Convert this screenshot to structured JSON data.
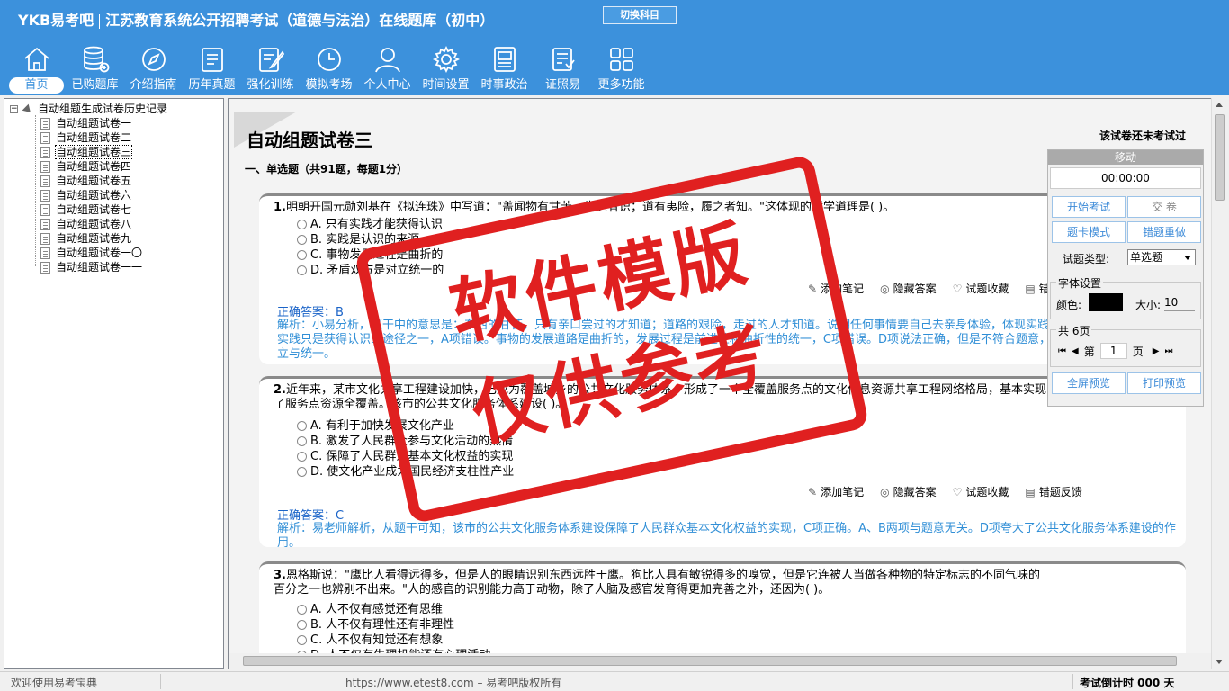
{
  "header": {
    "brand": "YKB易考吧",
    "title": "江苏教育系统公开招聘考试（道德与法治）在线题库（初中）",
    "switch_label": "切换科目"
  },
  "nav": [
    {
      "label": "首页",
      "icon": "home-icon"
    },
    {
      "label": "已购题库",
      "icon": "database-icon"
    },
    {
      "label": "介绍指南",
      "icon": "compass-icon"
    },
    {
      "label": "历年真题",
      "icon": "list-doc-icon"
    },
    {
      "label": "强化训练",
      "icon": "edit-doc-icon"
    },
    {
      "label": "模拟考场",
      "icon": "clock-icon"
    },
    {
      "label": "个人中心",
      "icon": "user-icon"
    },
    {
      "label": "时间设置",
      "icon": "gear-icon"
    },
    {
      "label": "时事政治",
      "icon": "news-icon"
    },
    {
      "label": "证照易",
      "icon": "certificate-icon"
    },
    {
      "label": "更多功能",
      "icon": "grid-icon"
    }
  ],
  "tree": {
    "root": "自动组题生成试卷历史记录",
    "items": [
      "自动组题试卷一",
      "自动组题试卷二",
      "自动组题试卷三",
      "自动组题试卷四",
      "自动组题试卷五",
      "自动组题试卷六",
      "自动组题试卷七",
      "自动组题试卷八",
      "自动组题试卷九",
      "自动组题试卷一〇",
      "自动组题试卷一一"
    ],
    "selected_index": 2
  },
  "paper": {
    "title": "自动组题试卷三",
    "status": "该试卷还未考试过",
    "section": "一、单选题（共91题，每题1分）"
  },
  "tools": {
    "note": "添加笔记",
    "hide": "隐藏答案",
    "fav": "试题收藏",
    "feedback": "错题反馈"
  },
  "questions": [
    {
      "num": "1.",
      "stem": "明朝开国元勋刘基在《拟连珠》中写道：\"盖闻物有甘苦，尝之者识；道有夷险，履之者知。\"这体现的哲学道理是( )。",
      "options": [
        "A. 只有实践才能获得认识",
        "B. 实践是认识的来源",
        "C. 事物发展过程是曲折的",
        "D. 矛盾双方是对立统一的"
      ],
      "tools": {
        "note": "添加笔记",
        "hide": "隐藏答案",
        "fav": "试题收藏",
        "feedback": "错题反馈"
      },
      "answer": "正确答案：B",
      "analysis": "解析：小易分析，题干中的意思是：东西的甘苦，只有亲口尝过的才知道；道路的艰险，走过的人才知道。说明任何事情要自己去亲身体验，体现实践是认识的来源，B项正确。实践只是获得认识的途径之一，A项错误。事物的发展道路是曲折的，发展过程是前进性和曲折性的统一，C项错误。D项说法正确，但是不符合题意，题干中没有体现矛盾的对立与统一。"
    },
    {
      "num": "2.",
      "stem": "近年来，某市文化共享工程建设加快，已成为覆盖城乡的公共文化服务体系，形成了一个全覆盖服务点的文化信息资源共享工程网络格局，基本实现了服务点资源全覆盖。该市的公共文化服务体系建设( )。",
      "options": [
        "A. 有利于加快发展文化产业",
        "B. 激发了人民群众参与文化活动的热情",
        "C. 保障了人民群众基本文化权益的实现",
        "D. 使文化产业成为国民经济支柱性产业"
      ],
      "tools": {
        "note": "添加笔记",
        "hide": "隐藏答案",
        "fav": "试题收藏",
        "feedback": "错题反馈"
      },
      "answer": "正确答案：C",
      "analysis": "解析：易老师解析，从题干可知，该市的公共文化服务体系建设保障了人民群众基本文化权益的实现，C项正确。A、B两项与题意无关。D项夸大了公共文化服务体系建设的作用。"
    },
    {
      "num": "3.",
      "stem": "恩格斯说：\"鹰比人看得远得多，但是人的眼睛识别东西远胜于鹰。狗比人具有敏锐得多的嗅觉，但是它连被人当做各种物的特定标志的不同气味的百分之一也辨别不出来。\"人的感官的识别能力高于动物，除了人脑及感官发育得更加完善之外，还因为( )。",
      "options": [
        "A. 人不仅有感觉还有思维",
        "B. 人不仅有理性还有非理性",
        "C. 人不仅有知觉还有想象",
        "D. 人不仅有生理机能还有心理活动"
      ]
    }
  ],
  "panel": {
    "header": "移动",
    "timer": "00:00:00",
    "start_exam": "开始考试",
    "submit": "交 卷",
    "card_mode": "题卡模式",
    "wrong_redo": "错题重做",
    "qtype_label": "试题类型:",
    "qtype_value": "单选题",
    "font_legend": "字体设置",
    "color_label": "颜色:",
    "color_value": "#000000",
    "size_label": "大小:",
    "size_value": "10",
    "pages_legend": "共 6页",
    "page_prefix": "第",
    "page_value": "1",
    "page_suffix": "页",
    "fullscreen": "全屏预览",
    "print": "打印预览"
  },
  "status_bar": {
    "welcome": "欢迎使用易考宝典",
    "url": "https://www.etest8.com – 易考吧版权所有",
    "countdown": "考试倒计时 000 天"
  },
  "watermark": {
    "line1": "软件模版",
    "line2": "仅供参考"
  },
  "colors": {
    "header_bg": "#3c91dc",
    "answer": "#1b64c8",
    "analysis": "#2f8ed6",
    "stamp": "#e02020"
  }
}
